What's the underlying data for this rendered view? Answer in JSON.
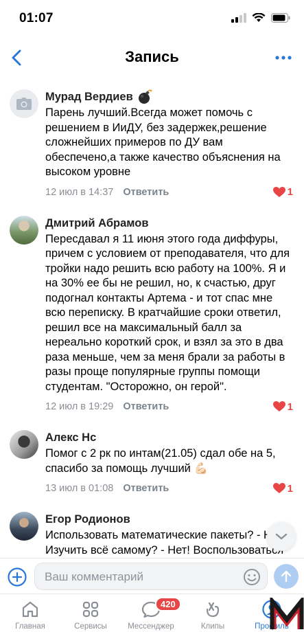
{
  "status_bar": {
    "time": "01:07"
  },
  "navbar": {
    "title": "Запись"
  },
  "comments": [
    {
      "author": "Мурад Вердиев",
      "badge_icon": "bomb-emoji",
      "text": "Парень лучший.Всегда может помочь с решением в ИиДУ, без задержек,решение сложнейших примеров по ДУ вам обеспечено,а также качество объяснения на высоком уровне",
      "date": "12 июл в 14:37",
      "reply": "Ответить",
      "likes": "1"
    },
    {
      "author": "Дмитрий Абрамов",
      "text": "Пересдавал я 11 июня этого года диффуры, причем с условием от преподавателя, что для тройки надо решить всю работу на 100%. Я и на 30% ее бы не решил, но, к счастью, друг подогнал контакты Артема - и тот спас мне всю переписку. В кратчайшие сроки ответил, решил все на максимальный балл за нереально короткий срок, и взял за это в два раза меньше, чем за меня брали за работы в разы проще популярные группы помощи студентам. \"Осторожно, он герой\".",
      "date": "12 июл в 19:29",
      "reply": "Ответить",
      "likes": "1"
    },
    {
      "author": "Алекс Нс",
      "text": "Помог с 2 рк по интам(21.05) сдал обе на 5, спасибо за помощь лучший 💪🏻",
      "date": "13 июл в 01:08",
      "reply": "Ответить",
      "likes": "1"
    },
    {
      "author": "Егор Родионов",
      "text": "Использовать математические пакеты? - Нет! Изучить всё самому? - Нет! Воспользоваться помощью Артема? - Да! Лучший в своем роде, быстро, качественно",
      "date": "",
      "reply": "",
      "likes": ""
    }
  ],
  "comment_input": {
    "placeholder": "Ваш комментарий"
  },
  "tabbar": {
    "tabs": [
      {
        "label": "Главная",
        "icon": "home-icon"
      },
      {
        "label": "Сервисы",
        "icon": "services-icon"
      },
      {
        "label": "Мессенджер",
        "icon": "messenger-icon",
        "badge": "420"
      },
      {
        "label": "Клипы",
        "icon": "clips-icon"
      },
      {
        "label": "Профиль",
        "icon": "profile-icon"
      }
    ]
  },
  "colors": {
    "accent": "#2a78d1",
    "like": "#e64646",
    "meta": "#8a8f96"
  }
}
